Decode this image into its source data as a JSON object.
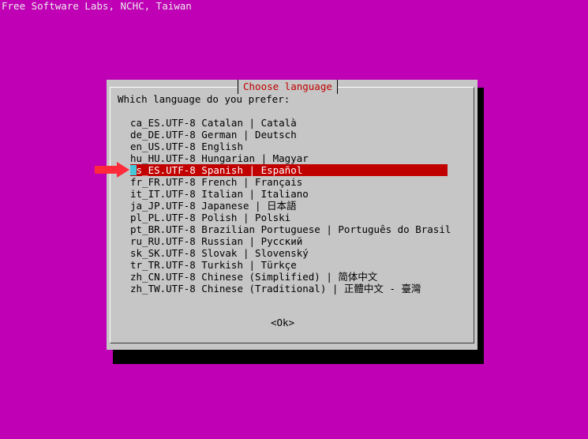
{
  "banner": {
    "text": "Free Software Labs, NCHC, Taiwan"
  },
  "dialog": {
    "title": "Choose language",
    "prompt": "Which language do you prefer:",
    "ok_label": "<Ok>",
    "selected_index": 4
  },
  "languages": [
    {
      "label": "ca_ES.UTF-8 Catalan | Català"
    },
    {
      "label": "de_DE.UTF-8 German | Deutsch"
    },
    {
      "label": "en_US.UTF-8 English"
    },
    {
      "label": "hu_HU.UTF-8 Hungarian | Magyar"
    },
    {
      "label": "es_ES.UTF-8 Spanish | Español"
    },
    {
      "label": "fr_FR.UTF-8 French | Français"
    },
    {
      "label": "it_IT.UTF-8 Italian | Italiano"
    },
    {
      "label": "ja_JP.UTF-8 Japanese | 日本語"
    },
    {
      "label": "pl_PL.UTF-8 Polish | Polski"
    },
    {
      "label": "pt_BR.UTF-8 Brazilian Portuguese | Português do Brasil"
    },
    {
      "label": "ru_RU.UTF-8 Russian | Русский"
    },
    {
      "label": "sk_SK.UTF-8 Slovak | Slovenský"
    },
    {
      "label": "tr_TR.UTF-8 Turkish | Türkçe"
    },
    {
      "label": "zh_CN.UTF-8 Chinese (Simplified) | 简体中文"
    },
    {
      "label": "zh_TW.UTF-8 Chinese (Traditional) | 正體中文 - 臺灣"
    }
  ],
  "colors": {
    "background": "#c000b5",
    "dialog": "#c6c6c6",
    "title_text": "#c00000",
    "selection": "#c10000",
    "cursor": "#46c8d8",
    "arrow": "#ff2b3a"
  },
  "icons": {
    "pointer": "red-arrow-icon"
  }
}
